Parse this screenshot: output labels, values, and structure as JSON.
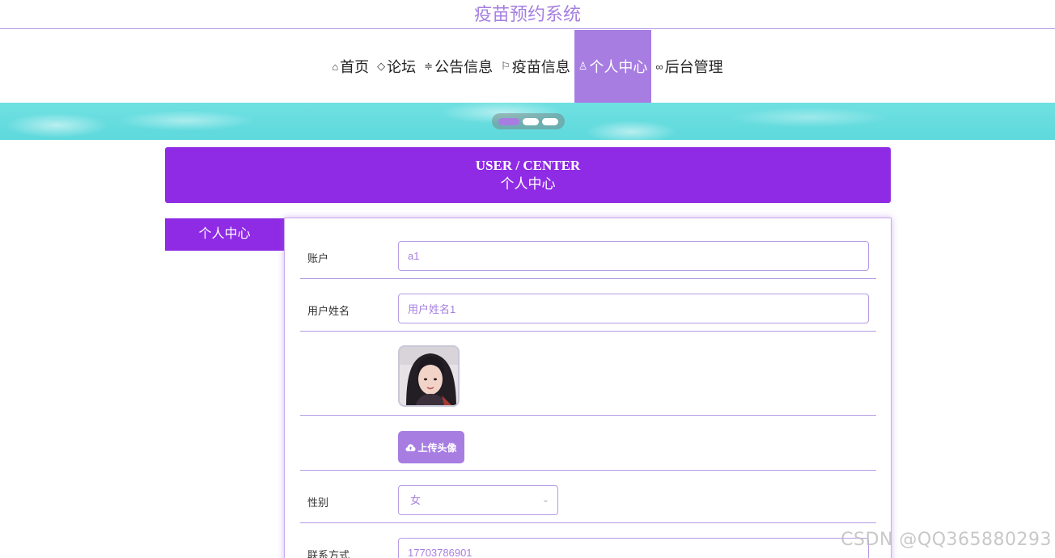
{
  "site": {
    "title": "疫苗预约系统"
  },
  "nav": {
    "items": [
      {
        "label": "首页",
        "icon": "home-icon",
        "glyph": "⌂",
        "active": false
      },
      {
        "label": "论坛",
        "icon": "tag-icon",
        "glyph": "◇",
        "active": false
      },
      {
        "label": "公告信息",
        "icon": "sliders-icon",
        "glyph": "≑",
        "active": false
      },
      {
        "label": "疫苗信息",
        "icon": "flag-icon",
        "glyph": "⚐",
        "active": false
      },
      {
        "label": "个人中心",
        "icon": "user-icon",
        "glyph": "♙",
        "active": true
      },
      {
        "label": "后台管理",
        "icon": "link-icon",
        "glyph": "∞",
        "active": false
      }
    ]
  },
  "banner": {
    "slides": 3,
    "active_slide": 1
  },
  "section": {
    "title_en": "USER / CENTER",
    "title_zh": "个人中心"
  },
  "side_menu": {
    "item": "个人中心"
  },
  "form": {
    "account": {
      "label": "账户",
      "value": "a1"
    },
    "username": {
      "label": "用户姓名",
      "value": "用户姓名1"
    },
    "upload": {
      "label": "上传头像",
      "icon": "cloud-upload-icon"
    },
    "gender": {
      "label": "性别",
      "value": "女",
      "icon": "chevron-down-icon"
    },
    "contact": {
      "label": "联系方式",
      "value": "17703786901"
    }
  },
  "watermark": "CSDN @QQ365880293",
  "colors": {
    "accent": "#a77de2",
    "primary": "#8f2be4",
    "banner": "#5ed9dc"
  }
}
